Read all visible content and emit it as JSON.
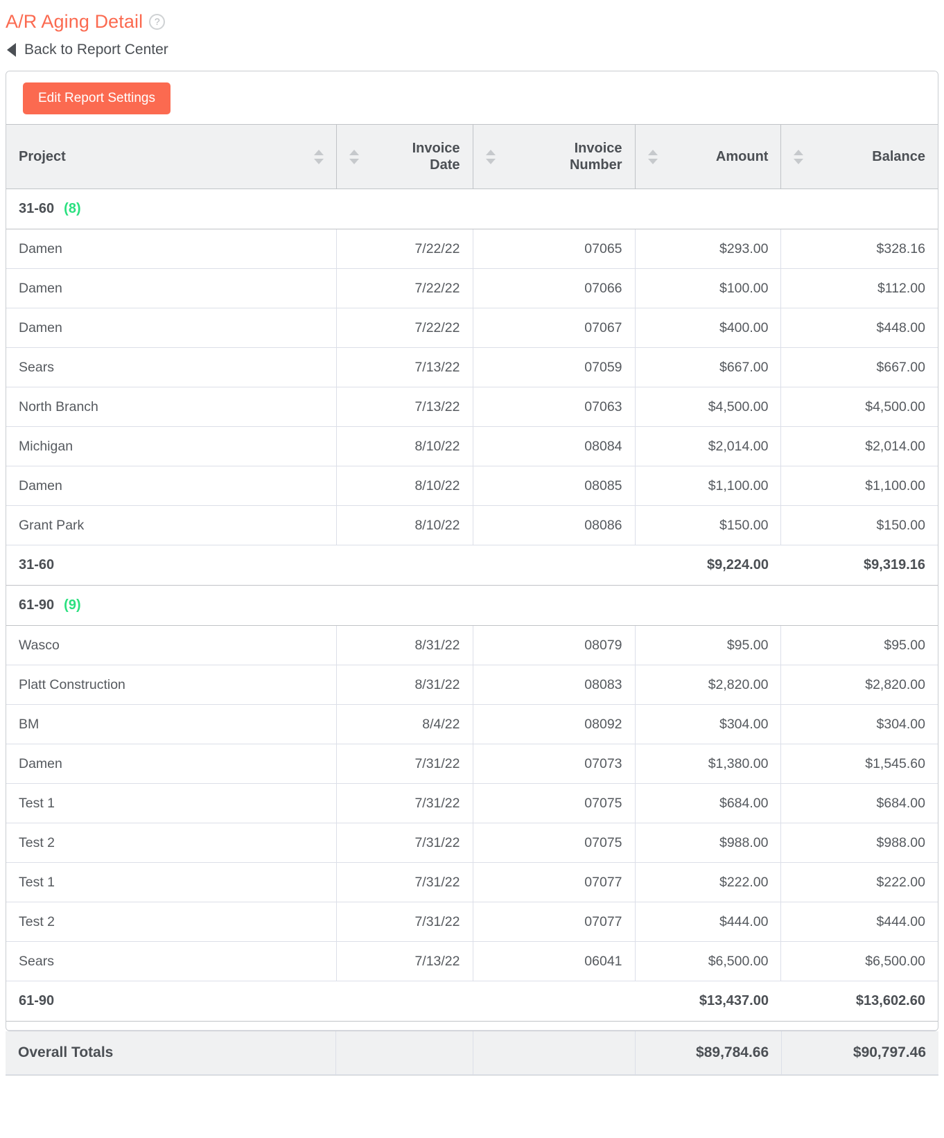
{
  "header": {
    "title": "A/R Aging Detail",
    "help_icon_glyph": "?",
    "back_link": "Back to Report Center"
  },
  "toolbar": {
    "edit_settings_label": "Edit Report Settings"
  },
  "table": {
    "columns": [
      {
        "label_line1": "Project",
        "label_line2": "",
        "align": "left"
      },
      {
        "label_line1": "Invoice",
        "label_line2": "Date",
        "align": "right"
      },
      {
        "label_line1": "Invoice",
        "label_line2": "Number",
        "align": "right"
      },
      {
        "label_line1": "Amount",
        "label_line2": "",
        "align": "right"
      },
      {
        "label_line1": "Balance",
        "label_line2": "",
        "align": "right"
      }
    ],
    "groups": [
      {
        "name": "31-60",
        "count": "(8)",
        "rows": [
          {
            "project": "Damen",
            "date": "7/22/22",
            "invoice": "07065",
            "amount": "$293.00",
            "balance": "$328.16"
          },
          {
            "project": "Damen",
            "date": "7/22/22",
            "invoice": "07066",
            "amount": "$100.00",
            "balance": "$112.00"
          },
          {
            "project": "Damen",
            "date": "7/22/22",
            "invoice": "07067",
            "amount": "$400.00",
            "balance": "$448.00"
          },
          {
            "project": "Sears",
            "date": "7/13/22",
            "invoice": "07059",
            "amount": "$667.00",
            "balance": "$667.00"
          },
          {
            "project": "North Branch",
            "date": "7/13/22",
            "invoice": "07063",
            "amount": "$4,500.00",
            "balance": "$4,500.00"
          },
          {
            "project": "Michigan",
            "date": "8/10/22",
            "invoice": "08084",
            "amount": "$2,014.00",
            "balance": "$2,014.00"
          },
          {
            "project": "Damen",
            "date": "8/10/22",
            "invoice": "08085",
            "amount": "$1,100.00",
            "balance": "$1,100.00"
          },
          {
            "project": "Grant Park",
            "date": "8/10/22",
            "invoice": "08086",
            "amount": "$150.00",
            "balance": "$150.00"
          }
        ],
        "total_label": "31-60",
        "total_amount": "$9,224.00",
        "total_balance": "$9,319.16"
      },
      {
        "name": "61-90",
        "count": "(9)",
        "rows": [
          {
            "project": "Wasco",
            "date": "8/31/22",
            "invoice": "08079",
            "amount": "$95.00",
            "balance": "$95.00"
          },
          {
            "project": "Platt Construction",
            "date": "8/31/22",
            "invoice": "08083",
            "amount": "$2,820.00",
            "balance": "$2,820.00"
          },
          {
            "project": "BM",
            "date": "8/4/22",
            "invoice": "08092",
            "amount": "$304.00",
            "balance": "$304.00"
          },
          {
            "project": "Damen",
            "date": "7/31/22",
            "invoice": "07073",
            "amount": "$1,380.00",
            "balance": "$1,545.60"
          },
          {
            "project": "Test 1",
            "date": "7/31/22",
            "invoice": "07075",
            "amount": "$684.00",
            "balance": "$684.00"
          },
          {
            "project": "Test 2",
            "date": "7/31/22",
            "invoice": "07075",
            "amount": "$988.00",
            "balance": "$988.00"
          },
          {
            "project": "Test 1",
            "date": "7/31/22",
            "invoice": "07077",
            "amount": "$222.00",
            "balance": "$222.00"
          },
          {
            "project": "Test 2",
            "date": "7/31/22",
            "invoice": "07077",
            "amount": "$444.00",
            "balance": "$444.00"
          },
          {
            "project": "Sears",
            "date": "7/13/22",
            "invoice": "06041",
            "amount": "$6,500.00",
            "balance": "$6,500.00"
          }
        ],
        "total_label": "61-90",
        "total_amount": "$13,437.00",
        "total_balance": "$13,602.60"
      }
    ]
  },
  "overall": {
    "label": "Overall Totals",
    "amount": "$89,784.66",
    "balance": "$90,797.46"
  },
  "colors": {
    "accent": "#fb6a50",
    "count_green": "#2ae07f",
    "header_bg": "#f0f1f2",
    "text": "#4b4f54"
  }
}
